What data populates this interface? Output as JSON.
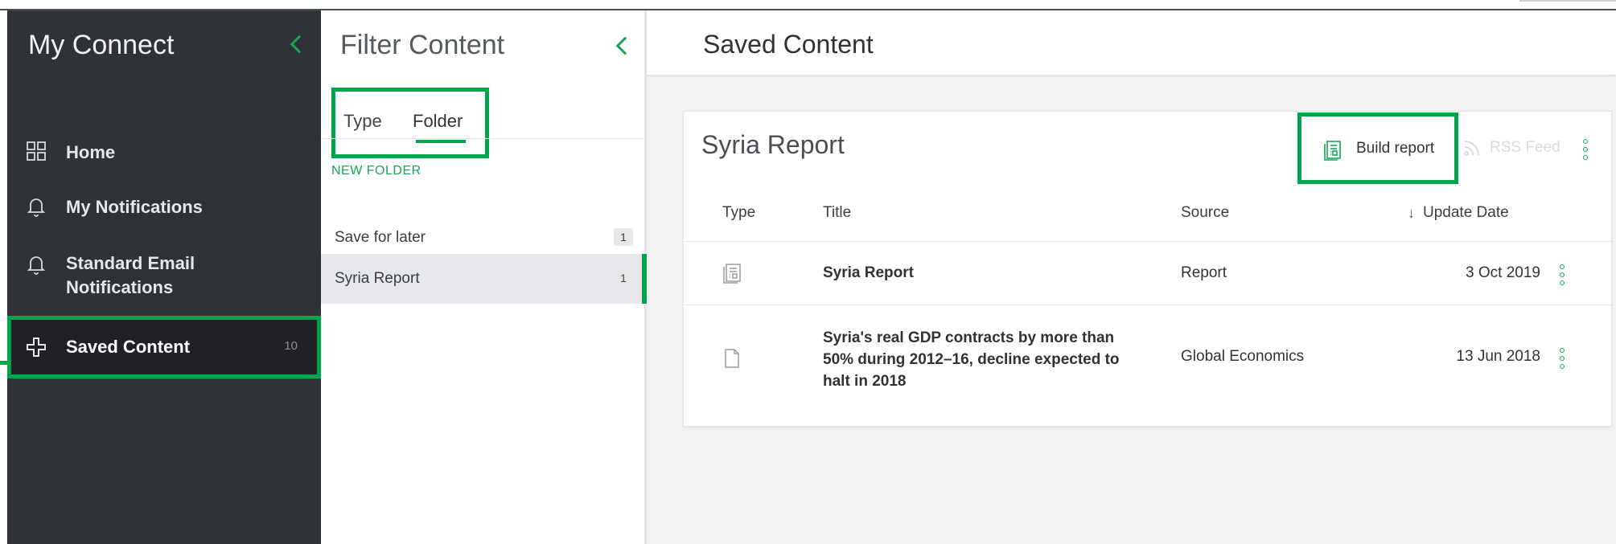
{
  "sidebar": {
    "title": "My Connect",
    "items": [
      {
        "label": "Home",
        "icon": "grid-icon"
      },
      {
        "label": "My Notifications",
        "icon": "bell-icon"
      },
      {
        "label": "Standard Email Notifications",
        "icon": "bell-icon"
      },
      {
        "label": "Saved Content",
        "icon": "bookmark-plus-icon",
        "count": "10"
      }
    ]
  },
  "filter": {
    "title": "Filter Content",
    "tabs": [
      {
        "label": "Type"
      },
      {
        "label": "Folder"
      }
    ],
    "new_folder": "NEW FOLDER",
    "folders": [
      {
        "name": "Save for later",
        "count": "1"
      },
      {
        "name": "Syria Report",
        "count": "1"
      }
    ]
  },
  "main": {
    "title": "Saved Content",
    "card": {
      "title": "Syria Report",
      "build_report": "Build report",
      "rss_feed": "RSS Feed",
      "columns": {
        "type": "Type",
        "title": "Title",
        "source": "Source",
        "date": "Update Date"
      },
      "rows": [
        {
          "type_icon": "report-icon",
          "title": "Syria Report",
          "source": "Report",
          "date": "3 Oct 2019"
        },
        {
          "type_icon": "document-icon",
          "title": "Syria's real GDP contracts by more than 50% during 2012–16, decline expected to halt in 2018",
          "source": "Global Economics",
          "date": "13 Jun 2018"
        }
      ]
    }
  },
  "colors": {
    "accent": "#00a44a",
    "sidebar_bg": "#2f3237"
  }
}
